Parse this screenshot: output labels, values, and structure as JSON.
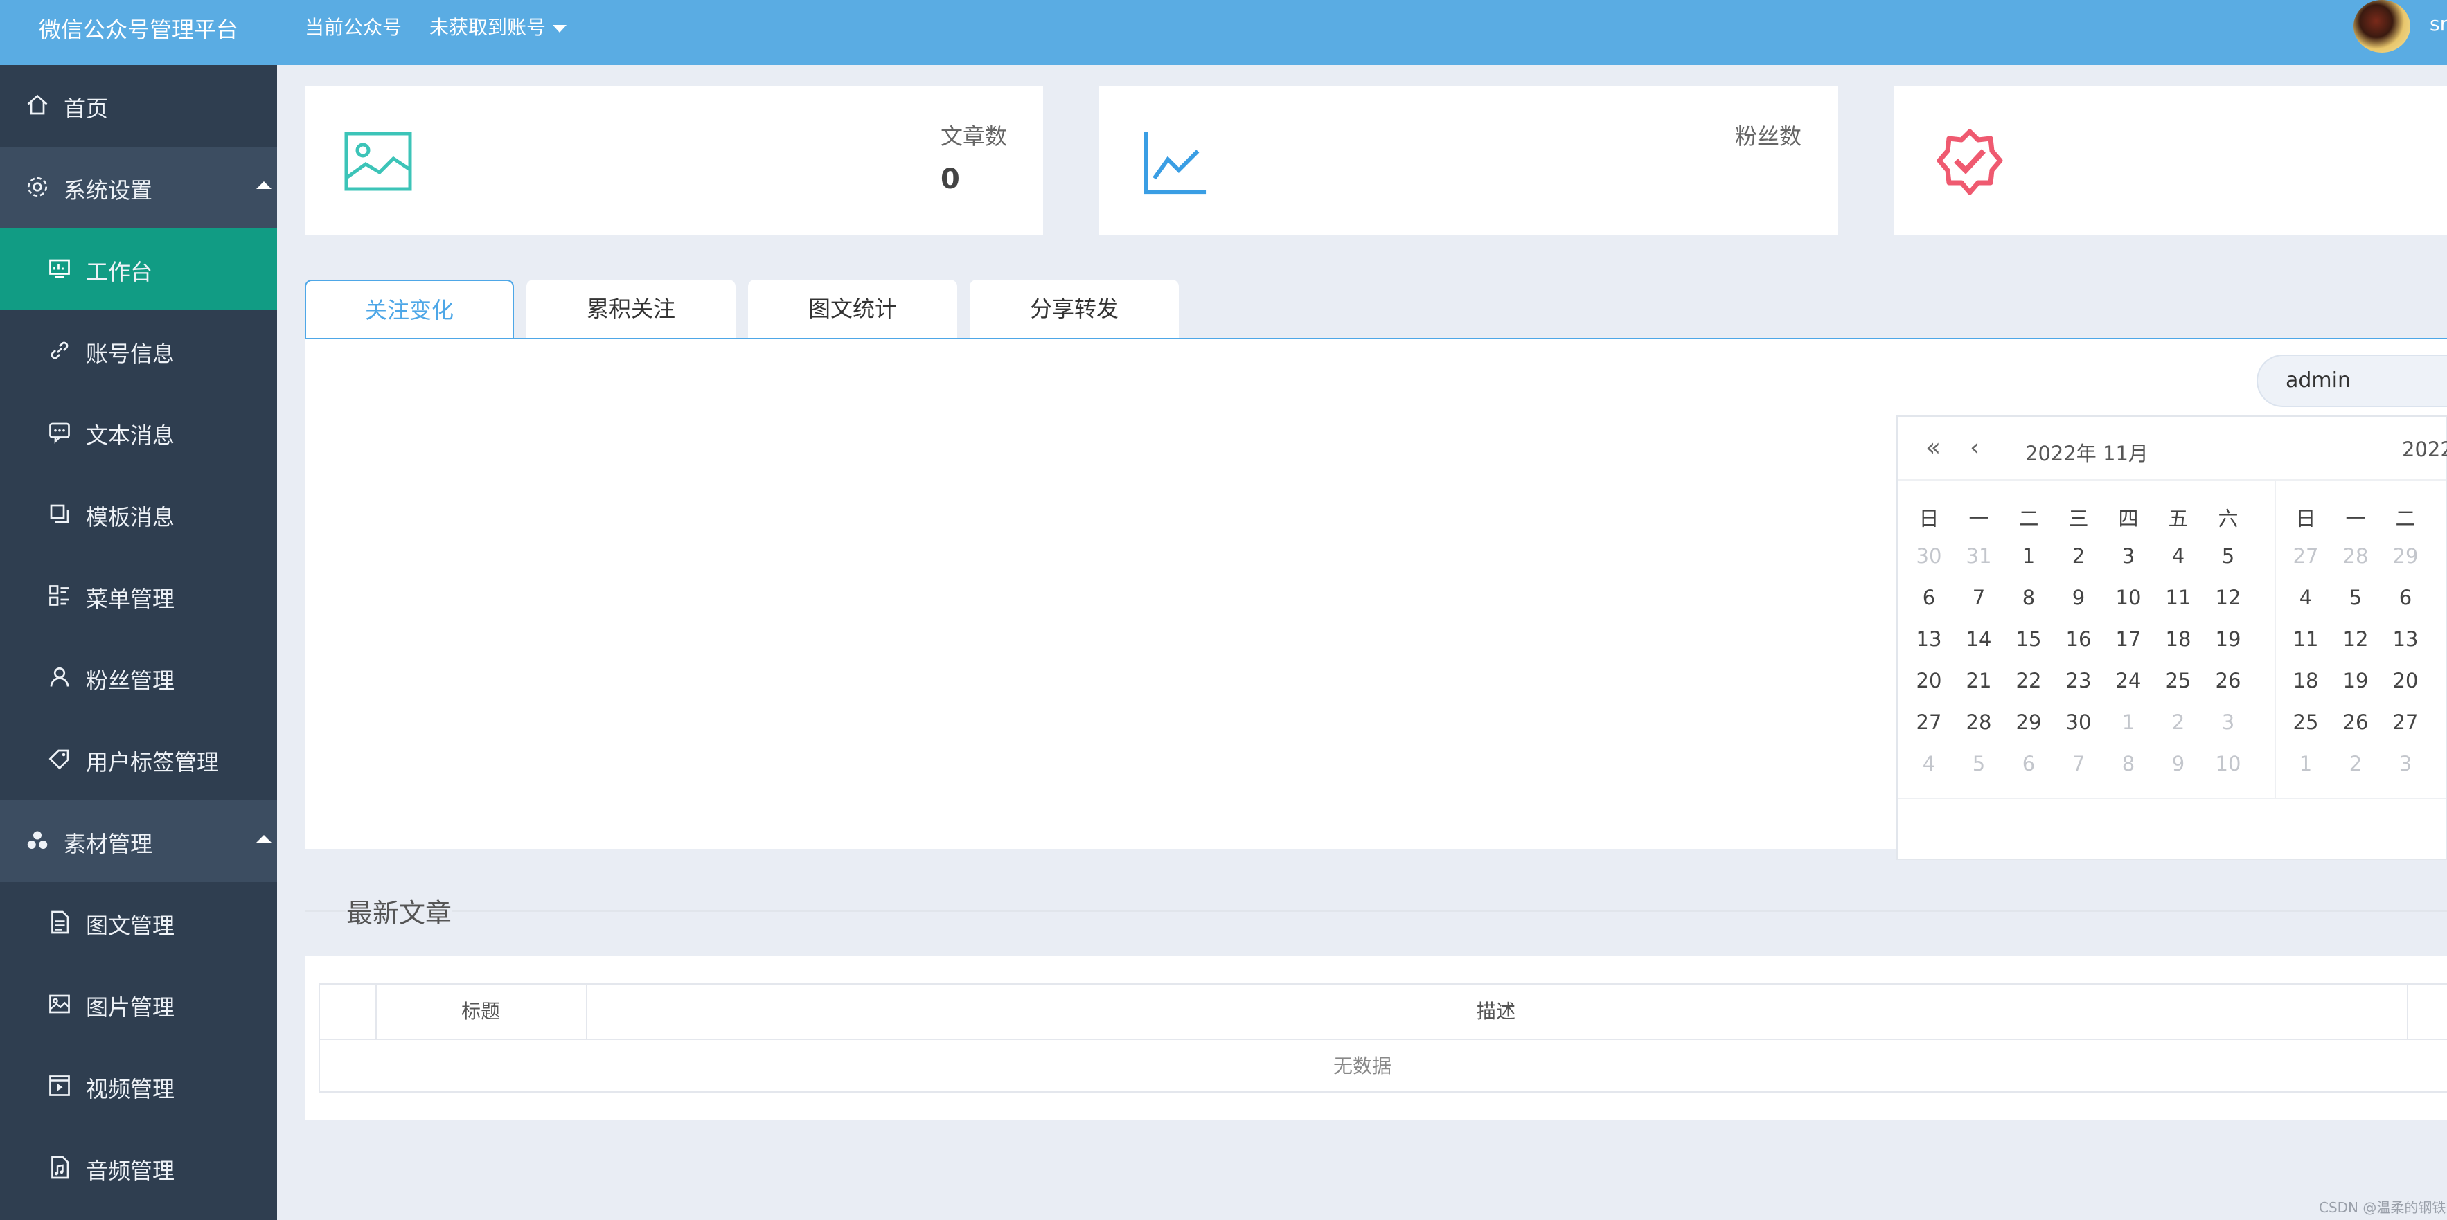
{
  "header": {
    "brand": "微信公众号管理平台",
    "current_account_label": "当前公众号",
    "account_select": "未获取到账号",
    "user_initial": "sr"
  },
  "sidebar": {
    "items": [
      {
        "label": "首页",
        "icon": "home-icon"
      },
      {
        "label": "系统设置",
        "icon": "gear-icon"
      },
      {
        "label": "工作台",
        "icon": "dashboard-icon"
      },
      {
        "label": "账号信息",
        "icon": "link-icon"
      },
      {
        "label": "文本消息",
        "icon": "message-icon"
      },
      {
        "label": "模板消息",
        "icon": "copy-icon"
      },
      {
        "label": "菜单管理",
        "icon": "menu-icon"
      },
      {
        "label": "粉丝管理",
        "icon": "user-icon"
      },
      {
        "label": "用户标签管理",
        "icon": "tag-icon"
      },
      {
        "label": "素材管理",
        "icon": "cluster-icon"
      },
      {
        "label": "图文管理",
        "icon": "document-icon"
      },
      {
        "label": "图片管理",
        "icon": "image-icon"
      },
      {
        "label": "视频管理",
        "icon": "video-icon"
      },
      {
        "label": "音频管理",
        "icon": "audio-file-icon"
      }
    ]
  },
  "stats": {
    "articles": {
      "label": "文章数",
      "value": "0",
      "icon": "picture-icon"
    },
    "fans": {
      "label": "粉丝数",
      "icon": "line-chart-icon"
    },
    "third": {
      "icon": "verified-badge-icon"
    }
  },
  "tabs": [
    {
      "label": "关注变化"
    },
    {
      "label": "累积关注"
    },
    {
      "label": "图文统计"
    },
    {
      "label": "分享转发"
    }
  ],
  "date_picker": {
    "value": "admin",
    "left_title": "2022年  11月",
    "right_title": "2022",
    "weekdays": [
      "日",
      "一",
      "二",
      "三",
      "四",
      "五",
      "六"
    ],
    "left_rows": [
      [
        "30",
        "31",
        "1",
        "2",
        "3",
        "4",
        "5"
      ],
      [
        "6",
        "7",
        "8",
        "9",
        "10",
        "11",
        "12"
      ],
      [
        "13",
        "14",
        "15",
        "16",
        "17",
        "18",
        "19"
      ],
      [
        "20",
        "21",
        "22",
        "23",
        "24",
        "25",
        "26"
      ],
      [
        "27",
        "28",
        "29",
        "30",
        "1",
        "2",
        "3"
      ],
      [
        "4",
        "5",
        "6",
        "7",
        "8",
        "9",
        "10"
      ]
    ],
    "left_muted": [
      [
        true,
        true,
        false,
        false,
        false,
        false,
        false
      ],
      [
        false,
        false,
        false,
        false,
        false,
        false,
        false
      ],
      [
        false,
        false,
        false,
        false,
        false,
        false,
        false
      ],
      [
        false,
        false,
        false,
        false,
        false,
        false,
        false
      ],
      [
        false,
        false,
        false,
        false,
        true,
        true,
        true
      ],
      [
        true,
        true,
        true,
        true,
        true,
        true,
        true
      ]
    ],
    "right_weekdays": [
      "日",
      "一",
      "二"
    ],
    "right_rows": [
      [
        "27",
        "28",
        "29"
      ],
      [
        "4",
        "5",
        "6"
      ],
      [
        "11",
        "12",
        "13"
      ],
      [
        "18",
        "19",
        "20"
      ],
      [
        "25",
        "26",
        "27"
      ],
      [
        "1",
        "2",
        "3"
      ]
    ],
    "right_muted": [
      [
        true,
        true,
        true
      ],
      [
        false,
        false,
        false
      ],
      [
        false,
        false,
        false
      ],
      [
        false,
        false,
        false
      ],
      [
        false,
        false,
        false
      ],
      [
        true,
        true,
        true
      ]
    ]
  },
  "latest": {
    "title": "最新文章",
    "columns": [
      "标题",
      "描述"
    ],
    "empty_text": "无数据"
  },
  "watermark": "CSDN @温柔的钢铁",
  "colors": {
    "header": "#5aace3",
    "sidebar": "#2f3e50",
    "active_menu": "#119c84",
    "tab_active": "#4ea7e7",
    "icon_teal": "#3cc4b8",
    "icon_blue": "#3a9ee4",
    "icon_red": "#ef5a70"
  }
}
